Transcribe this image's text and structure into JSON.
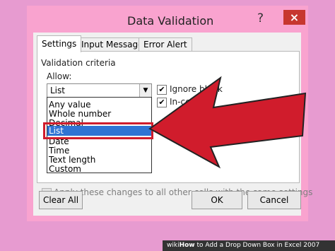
{
  "dialog": {
    "title": "Data Validation",
    "help_icon": "?",
    "close_icon": "×"
  },
  "tabs": [
    {
      "label": "Settings"
    },
    {
      "label": "Input Message"
    },
    {
      "label": "Error Alert"
    }
  ],
  "validation": {
    "criteria_label": "Validation criteria",
    "allow_label": "Allow:",
    "allow_value": "List",
    "options": [
      "Any value",
      "Whole number",
      "Decimal",
      "List",
      "Date",
      "Time",
      "Text length",
      "Custom"
    ],
    "selected_option": "List"
  },
  "checks": {
    "ignore_blank": "Ignore blank",
    "in_cell": "In-cell dr"
  },
  "apply_all": "Apply these changes to all other cells with the same settings",
  "buttons": {
    "clear_all": "Clear All",
    "ok": "OK",
    "cancel": "Cancel"
  },
  "footer": {
    "brand": "wiki",
    "brand_strong": "How",
    "text": " to Add a Drop Down Box in Excel 2007"
  },
  "colors": {
    "background": "#e79bd0",
    "arrow": "#d01c2c",
    "selection": "#3074d4"
  }
}
